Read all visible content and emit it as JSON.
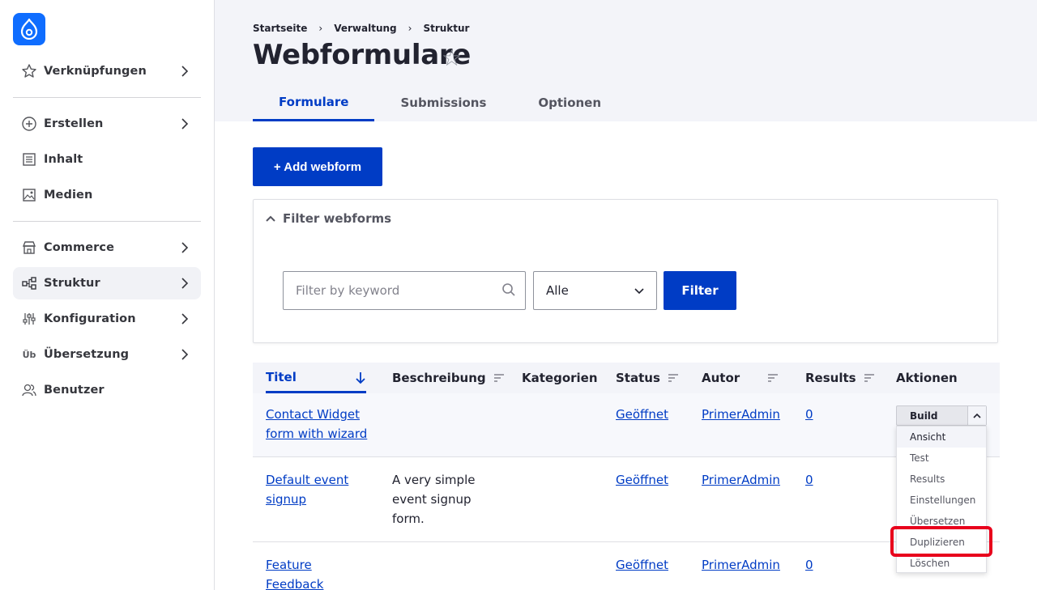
{
  "sidebar": {
    "items": [
      {
        "label": "Verknüpfungen",
        "icon": "star-icon"
      },
      {
        "label": "Erstellen",
        "icon": "plus-circle-icon"
      },
      {
        "label": "Inhalt",
        "icon": "document-icon"
      },
      {
        "label": "Medien",
        "icon": "image-icon"
      },
      {
        "label": "Commerce",
        "icon": "shop-icon"
      },
      {
        "label": "Struktur",
        "icon": "structure-icon"
      },
      {
        "label": "Konfiguration",
        "icon": "sliders-icon"
      },
      {
        "label": "Übersetzung",
        "icon": "translate-icon",
        "glyph": "Üb"
      },
      {
        "label": "Benutzer",
        "icon": "users-icon"
      }
    ]
  },
  "breadcrumb": [
    "Startseite",
    "Verwaltung",
    "Struktur"
  ],
  "breadcrumb_sep": "›",
  "page_title": "Webformulare",
  "star_glyph": "☆",
  "tabs": [
    "Formulare",
    "Submissions",
    "Optionen"
  ],
  "add_button": "+ Add webform",
  "filter": {
    "title": "Filter webforms",
    "placeholder": "Filter by keyword",
    "select_value": "Alle",
    "button": "Filter"
  },
  "table": {
    "headers": [
      "Titel",
      "Beschreibung",
      "Kategorien",
      "Status",
      "Autor",
      "Results",
      "Aktionen"
    ],
    "rows": [
      {
        "title_l1": "Contact Widget",
        "title_l2": "form with wizard",
        "title_l3": "",
        "desc_l1": "",
        "desc_l2": "",
        "desc_l3": "",
        "status": "Geöffnet",
        "author": "PrimerAdmin",
        "results": "0"
      },
      {
        "title_l1": "Default event",
        "title_l2": "signup",
        "title_l3": "",
        "desc_l1": "A very simple",
        "desc_l2": "event signup",
        "desc_l3": "form.",
        "status": "Geöffnet",
        "author": "PrimerAdmin",
        "results": "0"
      },
      {
        "title_l1": "Feature",
        "title_l2": "Feedback",
        "title_l3": "",
        "desc_l1": "",
        "desc_l2": "",
        "desc_l3": "",
        "status": "Geöffnet",
        "author": "PrimerAdmin",
        "results": "0"
      }
    ]
  },
  "actions": {
    "button": "Build",
    "menu": [
      "Ansicht",
      "Test",
      "Results",
      "Einstellungen",
      "Übersetzen",
      "Duplizieren",
      "Löschen"
    ]
  },
  "colors": {
    "accent": "#003cc5",
    "highlight": "#e8001c"
  }
}
